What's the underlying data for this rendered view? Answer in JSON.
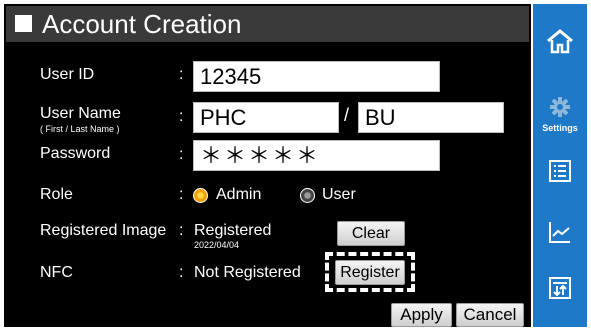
{
  "title": "Account Creation",
  "fields": {
    "user_id": {
      "label": "User ID",
      "value": "12345"
    },
    "user_name": {
      "label": "User Name",
      "sublabel": "( First / Last Name )",
      "first": "PHC",
      "separator": "/",
      "last": "BU"
    },
    "password": {
      "label": "Password",
      "value": "＊＊＊＊＊"
    },
    "role": {
      "label": "Role",
      "options": [
        "Admin",
        "User"
      ],
      "selected": "Admin"
    },
    "registered_image": {
      "label": "Registered Image",
      "status": "Registered",
      "date": "2022/04/04",
      "clear_label": "Clear"
    },
    "nfc": {
      "label": "NFC",
      "status": "Not Registered",
      "register_label": "Register"
    }
  },
  "colon": ":",
  "footer": {
    "apply_label": "Apply",
    "cancel_label": "Cancel"
  },
  "sidebar": {
    "items": [
      {
        "icon": "home-icon"
      },
      {
        "icon": "gear-icon",
        "label": "Settings"
      },
      {
        "icon": "list-icon"
      },
      {
        "icon": "line-chart-icon"
      },
      {
        "icon": "sort-icon"
      }
    ]
  },
  "colors": {
    "sidebar": "#1e7ac8",
    "background": "#000000",
    "titlebar": "#3a3a3a",
    "radio_selected": "#f0a000"
  }
}
